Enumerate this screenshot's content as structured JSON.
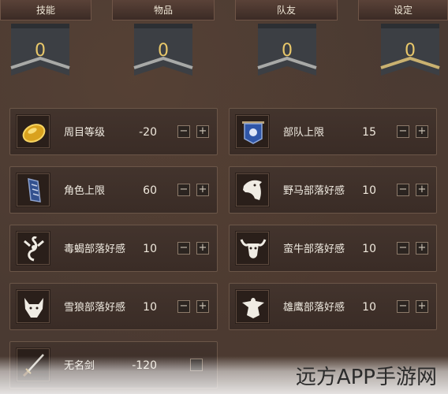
{
  "tabs": [
    "技能",
    "物品",
    "队友",
    "设定"
  ],
  "banners": [
    {
      "value": "0",
      "trim": "silver"
    },
    {
      "value": "0",
      "trim": "silver"
    },
    {
      "value": "0",
      "trim": "silver"
    },
    {
      "value": "0",
      "trim": "gold"
    }
  ],
  "items": [
    {
      "name": "周目等级",
      "value": "-20",
      "icon": "gold-coin-icon",
      "active": true
    },
    {
      "name": "部队上限",
      "value": "15",
      "icon": "blue-flag-icon",
      "active": true
    },
    {
      "name": "角色上限",
      "value": "60",
      "icon": "blue-banner-icon",
      "active": true
    },
    {
      "name": "野马部落好感",
      "value": "10",
      "icon": "horse-head-icon",
      "active": true
    },
    {
      "name": "毒蝎部落好感",
      "value": "10",
      "icon": "scorpion-icon",
      "active": true
    },
    {
      "name": "蛮牛部落好感",
      "value": "10",
      "icon": "bull-head-icon",
      "active": true
    },
    {
      "name": "雪狼部落好感",
      "value": "10",
      "icon": "wolf-head-icon",
      "active": true
    },
    {
      "name": "雄鹰部落好感",
      "value": "10",
      "icon": "eagle-icon",
      "active": true
    },
    {
      "name": "无名剑",
      "value": "-120",
      "icon": "sword-icon",
      "active": false
    }
  ],
  "buttons": {
    "minus": "−",
    "plus": "+"
  },
  "watermark": "远方APP手游网",
  "colors": {
    "currency": "#8a58b8",
    "gold": "#e9c86a"
  }
}
